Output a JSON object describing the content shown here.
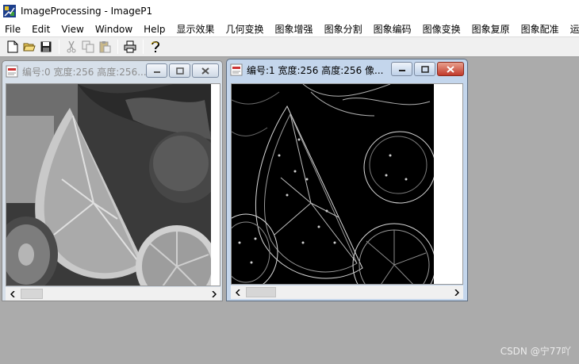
{
  "app": {
    "title": "ImageProcessing - ImageP1"
  },
  "menu": {
    "items": [
      "File",
      "Edit",
      "View",
      "Window",
      "Help",
      "显示效果",
      "几何变换",
      "图象增强",
      "图象分割",
      "图象编码",
      "图像变换",
      "图象复原",
      "图象配准",
      "运动"
    ]
  },
  "toolbar": {
    "icons": [
      "new-file-icon",
      "open-folder-icon",
      "save-icon",
      "cut-icon",
      "copy-icon",
      "paste-icon",
      "print-icon",
      "help-icon"
    ]
  },
  "windows": [
    {
      "caption": "编号:0 宽度:256 高度:256...",
      "state": "inactive",
      "image": "grayscale fruit photo"
    },
    {
      "caption": "编号:1 宽度:256 高度:256 像...",
      "state": "active",
      "image": "edge-detected fruit image"
    }
  ],
  "watermark": "CSDN @宁77吖",
  "colors": {
    "mdi_background": "#ababab",
    "active_frame": "#c4d6ec",
    "inactive_frame": "#d7e0ea",
    "close_button_active": "#c1392b"
  }
}
